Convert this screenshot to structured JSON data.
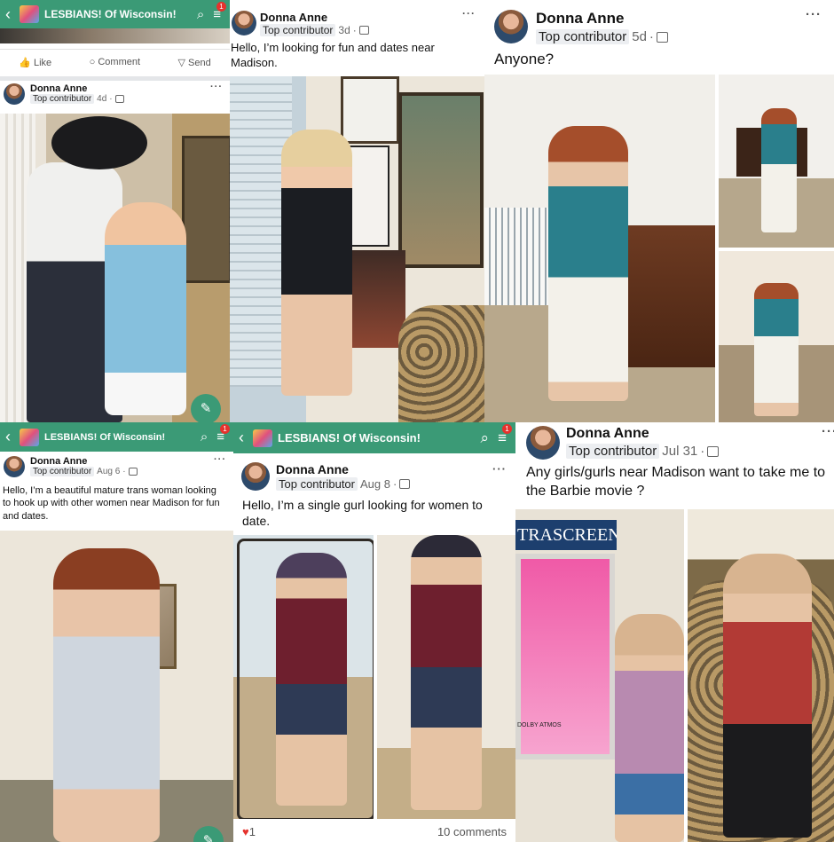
{
  "colors": {
    "group_bar": "#3b9a76",
    "badge": "#e5322d",
    "tag_bg": "#eceef1"
  },
  "group": {
    "name": "LESBIANS! Of Wisconsin!",
    "notification_count": "1",
    "back_icon": "chevron-left-icon",
    "search_icon": "search-icon",
    "menu_icon": "menu-icon"
  },
  "actions": {
    "like": "Like",
    "comment": "Comment",
    "send": "Send"
  },
  "author": {
    "name": "Donna Anne",
    "badge": "Top contributor"
  },
  "posts": [
    {
      "date": "4d",
      "text": ""
    },
    {
      "date": "3d",
      "text": "Hello, I’m looking for fun and dates near Madison."
    },
    {
      "date": "5d",
      "text": "Anyone?"
    },
    {
      "date": "Aug 6",
      "text": "Hello, I’m a beautiful mature trans woman looking to hook up with other women near Madison for fun and dates."
    },
    {
      "date": "Aug 8",
      "text": "Hello, I’m a single gurl looking for women to date.",
      "reactions": "1",
      "comments": "10 comments"
    },
    {
      "date": "Jul 31",
      "text": "Any girls/gurls near Madison want to take me to the Barbie movie ?"
    }
  ],
  "poster": {
    "brand": "TRASCREEN",
    "footer": "DOLBY ATMOS"
  },
  "more_label": "···",
  "fab_icon": "✎"
}
